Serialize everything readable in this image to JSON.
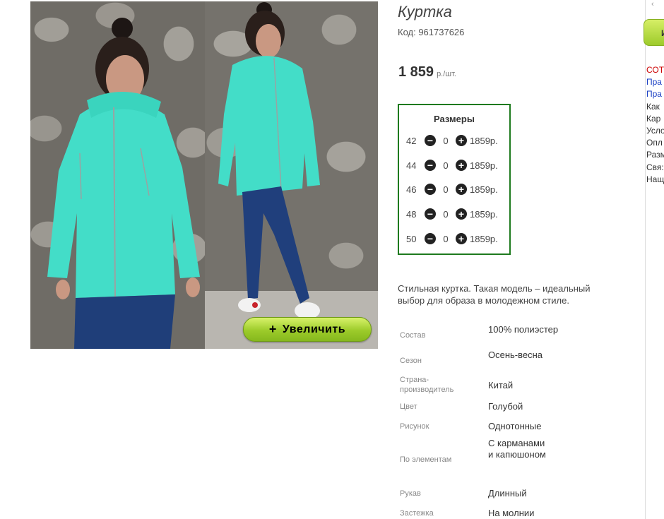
{
  "product": {
    "title": "Куртка",
    "code": "Код: 961737626",
    "price_value": "1 859",
    "price_unit": "р./шт.",
    "zoom_label": "Увеличить",
    "zoom_plus": "+",
    "description": "Стильная куртка. Такая модель – идеальный выбор для образа в молодежном стиле."
  },
  "sizes": {
    "title": "Размеры",
    "minus_glyph": "−",
    "plus_glyph": "+",
    "rows": [
      {
        "size": "42",
        "qty": "0",
        "price": "1859р."
      },
      {
        "size": "44",
        "qty": "0",
        "price": "1859р."
      },
      {
        "size": "46",
        "qty": "0",
        "price": "1859р."
      },
      {
        "size": "48",
        "qty": "0",
        "price": "1859р."
      },
      {
        "size": "50",
        "qty": "0",
        "price": "1859р."
      }
    ]
  },
  "specs": [
    {
      "key": "Состав",
      "value": "100% полиэстер"
    },
    {
      "key": "Сезон",
      "value": "Осень-весна"
    },
    {
      "key": "Страна-производитель",
      "value": "Китай"
    },
    {
      "key": "Цвет",
      "value": "Голубой"
    },
    {
      "key": "Рисунок",
      "value": "Однотонные"
    },
    {
      "key": "По элементам",
      "value": "С карманами и капюшоном"
    },
    {
      "key": "Рукав",
      "value": "Длинный"
    },
    {
      "key": "Застежка",
      "value": "На молнии"
    }
  ],
  "sidebar": {
    "top_text": "‹",
    "button_label": "И",
    "links": [
      {
        "label": "СОТ",
        "color": "#cc0000"
      },
      {
        "label": "Пра",
        "color": "#1a3fc4"
      },
      {
        "label": "Пра",
        "color": "#1a3fc4"
      },
      {
        "label": "Как",
        "color": "#333333"
      },
      {
        "label": "Кар",
        "color": "#333333"
      },
      {
        "label": "Усло",
        "color": "#333333"
      },
      {
        "label": "Опл",
        "color": "#333333"
      },
      {
        "label": "Разм",
        "color": "#333333"
      },
      {
        "label": "Свя:",
        "color": "#333333"
      },
      {
        "label": "Нащ",
        "color": "#333333"
      }
    ]
  },
  "colors": {
    "jacket": "#3fe0c8",
    "frame": "#1e7a1e",
    "zoom_button": "#a8d435"
  }
}
